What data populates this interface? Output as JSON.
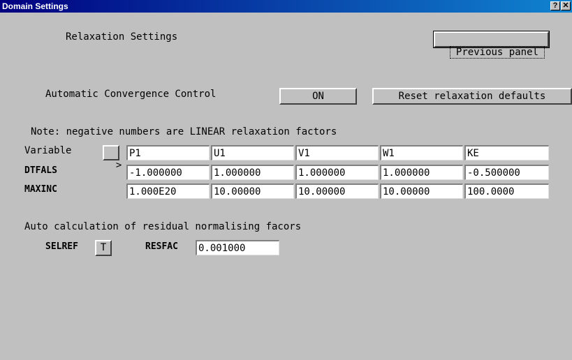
{
  "window": {
    "title": "Domain Settings",
    "help_label": "?",
    "close_label": "✕"
  },
  "panel": {
    "heading": "Relaxation Settings",
    "previous_panel_label": "Previous panel",
    "acc_label": "Automatic Convergence Control",
    "acc_value": "ON",
    "reset_label": "Reset relaxation defaults",
    "note": "Note: negative numbers are LINEAR relaxation factors"
  },
  "table": {
    "variable_label": "Variable",
    "next_label": ">",
    "variables": [
      "P1",
      "U1",
      "V1",
      "W1",
      "KE"
    ],
    "rows": [
      {
        "label": "DTFALS",
        "values": [
          "-1.000000",
          "1.000000",
          "1.000000",
          "1.000000",
          "-0.500000"
        ]
      },
      {
        "label": "MAXINC",
        "values": [
          "1.000E20",
          "10.00000",
          "10.00000",
          "10.00000",
          "100.0000"
        ]
      }
    ]
  },
  "residual": {
    "heading": "Auto calculation of residual normalising facors",
    "selref_label": "SELREF",
    "selref_value": "T",
    "resfac_label": "RESFAC",
    "resfac_value": "0.001000"
  }
}
